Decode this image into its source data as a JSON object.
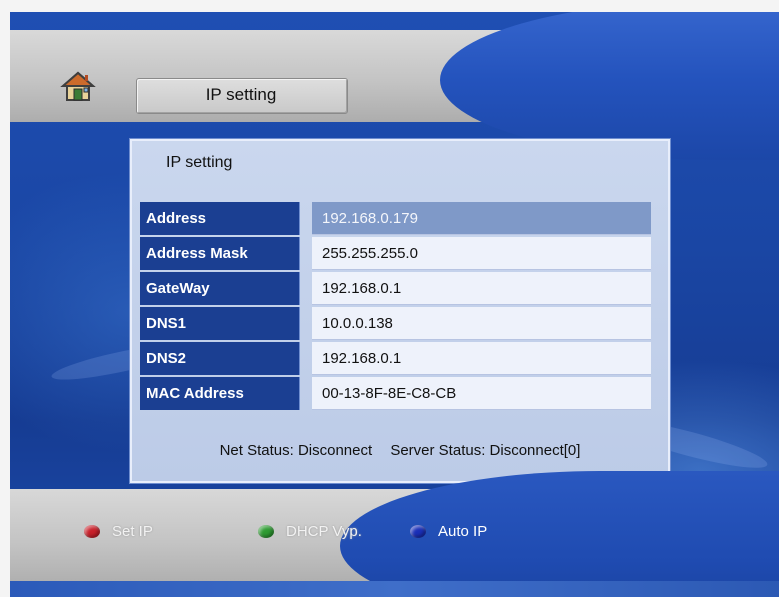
{
  "header": {
    "title": "IP setting",
    "home_icon": "home-icon"
  },
  "panel": {
    "title": "IP setting",
    "rows": [
      {
        "label": "Address",
        "value": "192.168.0.179",
        "selected": true
      },
      {
        "label": "Address Mask",
        "value": "255.255.255.0"
      },
      {
        "label": "GateWay",
        "value": "192.168.0.1"
      },
      {
        "label": "DNS1",
        "value": "10.0.0.138"
      },
      {
        "label": "DNS2",
        "value": "192.168.0.1"
      },
      {
        "label": "MAC Address",
        "value": "00-13-8F-8E-C8-CB"
      }
    ],
    "net_status": "Net Status: Disconnect",
    "server_status": "Server Status: Disconnect[0]"
  },
  "footer": {
    "buttons": [
      {
        "label": "Set IP",
        "color": "#c8202a",
        "icon": "red-dot-icon"
      },
      {
        "label": "DHCP Vyp.",
        "color": "#2e9b32",
        "icon": "green-dot-icon"
      },
      {
        "label": "Auto IP",
        "color": "#1a2fb8",
        "icon": "blue-dot-icon"
      }
    ]
  },
  "colors": {
    "background_blue": "#1a46a4",
    "label_blue": "#1b3f92",
    "selected_value": "#7f99c8",
    "panel": "#c4d1ea"
  }
}
